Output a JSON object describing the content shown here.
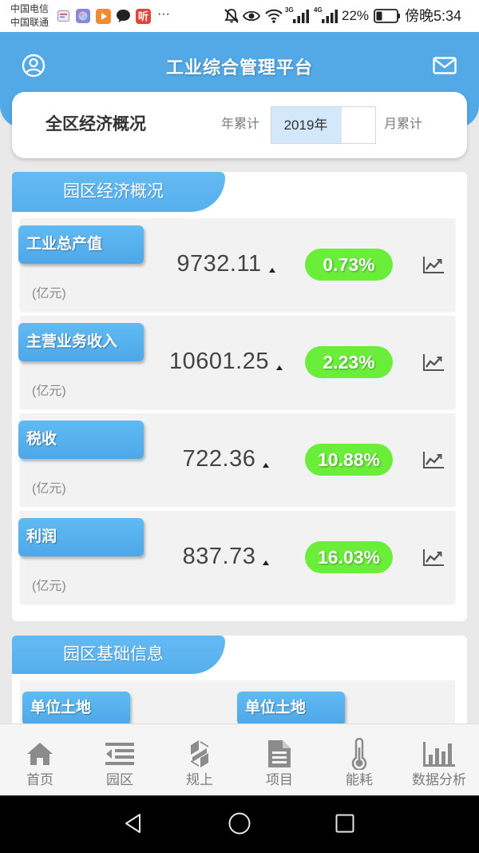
{
  "status_bar": {
    "carriers": [
      "中国电信",
      "中国联通"
    ],
    "app_badge_text": "听",
    "more": "···",
    "network_labels": [
      "3G",
      "4G"
    ],
    "battery_percent": "22%",
    "time": "傍晚5:34",
    "icons": [
      "message-icon",
      "app-icon",
      "video-icon",
      "chat-bubble-icon",
      "mute-icon",
      "eye-icon",
      "wifi-icon",
      "signal-icon",
      "battery-icon"
    ]
  },
  "header": {
    "title": "工业综合管理平台",
    "left_icon": "user-icon",
    "right_icon": "mail-icon"
  },
  "overview": {
    "title": "全区经济概况",
    "year_cumulative_label": "年累计",
    "year_value": "2019年",
    "month_cumulative_label": "月累计"
  },
  "park_economy": {
    "title": "园区经济概况",
    "metrics": [
      {
        "label": "工业总产值",
        "value": "9732.11",
        "trend_icon": "trend-up-icon",
        "change": "0.73%",
        "unit": "(亿元)"
      },
      {
        "label": "主营业务收入",
        "value": "10601.25",
        "trend_icon": "trend-up-icon",
        "change": "2.23%",
        "unit": "(亿元)"
      },
      {
        "label": "税收",
        "value": "722.36",
        "trend_icon": "trend-up-icon",
        "change": "10.88%",
        "unit": "(亿元)"
      },
      {
        "label": "利润",
        "value": "837.73",
        "trend_icon": "trend-up-icon",
        "change": "16.03%",
        "unit": "(亿元)"
      }
    ]
  },
  "park_info": {
    "title": "园区基础信息",
    "items": [
      {
        "label": "单位土地"
      },
      {
        "label": "单位土地"
      }
    ]
  },
  "bottom_nav": {
    "items": [
      {
        "label": "首页",
        "icon": "home-icon"
      },
      {
        "label": "园区",
        "icon": "list-indent-icon"
      },
      {
        "label": "规上",
        "icon": "enterprise-logo-icon"
      },
      {
        "label": "项目",
        "icon": "document-icon"
      },
      {
        "label": "能耗",
        "icon": "thermometer-icon"
      },
      {
        "label": "数据分析",
        "icon": "bar-chart-icon"
      }
    ]
  },
  "system_nav": {
    "icons": [
      "back-icon",
      "home-circle-icon",
      "recents-icon"
    ]
  },
  "colors": {
    "header_blue": "#52a9e6",
    "tab_blue": "#56b0ee",
    "label_blue": "#4ea8e8",
    "change_green": "#6aee3a",
    "page_background": "#e9e9e9",
    "row_background": "#f2f2f2",
    "year_selected_background": "#d3e8fa",
    "nav_icon_gray": "#8c8c8c"
  }
}
